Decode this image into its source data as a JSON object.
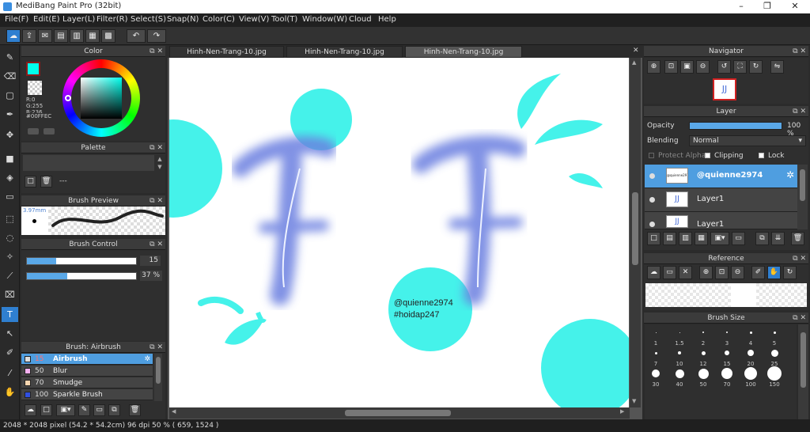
{
  "window": {
    "title": "MediBang Paint Pro (32bit)"
  },
  "menu": [
    "File(F)",
    "Edit(E)",
    "Layer(L)",
    "Filter(R)",
    "Select(S)",
    "Snap(N)",
    "Color(C)",
    "View(V)",
    "Tool(T)",
    "Window(W)",
    "Cloud",
    "Help"
  ],
  "tabs": [
    "Hinh-Nen-Trang-10.jpg",
    "Hinh-Nen-Trang-10.jpg",
    "Hinh-Nen-Trang-10.jpg"
  ],
  "color_panel": {
    "title": "Color",
    "r": "R:0",
    "g": "G:255",
    "b": "B:236",
    "hex": "#00FFEC",
    "accent": "#00ffec"
  },
  "palette_panel": {
    "title": "Palette",
    "empty": "---"
  },
  "brush_preview": {
    "title": "Brush Preview",
    "size": "3.97mm"
  },
  "brush_control": {
    "title": "Brush Control",
    "size_value": "15",
    "size_fraction": 0.27,
    "opacity_value": "37 %",
    "opacity_fraction": 0.37
  },
  "brush_list": {
    "title": "Brush: Airbrush",
    "items": [
      {
        "size": "15",
        "name": "Airbrush",
        "color": "#dddddd",
        "selected": true
      },
      {
        "size": "50",
        "name": "Blur",
        "color": "#f4b0f0",
        "selected": false
      },
      {
        "size": "70",
        "name": "Smudge",
        "color": "#f6d6b0",
        "selected": false
      },
      {
        "size": "100",
        "name": "Sparkle Brush",
        "color": "#3050e0",
        "selected": false
      }
    ]
  },
  "canvas_text": {
    "line1": "@quienne2974",
    "line2": "#hoidap247"
  },
  "navigator": {
    "title": "Navigator",
    "thumb_text": "JJ"
  },
  "layer_panel": {
    "title": "Layer",
    "opacity_label": "Opacity",
    "opacity_value": "100 %",
    "opacity_fraction": 1.0,
    "blending_label": "Blending",
    "blending_value": "Normal",
    "protect_alpha": "Protect Alpha",
    "clipping": "Clipping",
    "lock": "Lock",
    "layers": [
      {
        "name": "@quienne2974",
        "thumb_text": "@quienne2974",
        "selected": true
      },
      {
        "name": "Layer1",
        "thumb_text": "JJ",
        "selected": false
      },
      {
        "name": "Layer1",
        "thumb_text": "JJ",
        "selected": false
      }
    ]
  },
  "reference_panel": {
    "title": "Reference"
  },
  "brush_size_panel": {
    "title": "Brush Size",
    "sizes": [
      "1",
      "1.5",
      "2",
      "3",
      "4",
      "5",
      "7",
      "10",
      "12",
      "15",
      "20",
      "25",
      "30",
      "40",
      "50",
      "70",
      "100",
      "150"
    ]
  },
  "status": {
    "text": "2048 * 2048 pixel   (54.2 * 54.2cm)   96 dpi   50 %   ( 659, 1524 )"
  },
  "colors": {
    "accent_blue": "#2f7fd0",
    "cyan": "#45f2ea",
    "ink": "#6a7fe0"
  }
}
